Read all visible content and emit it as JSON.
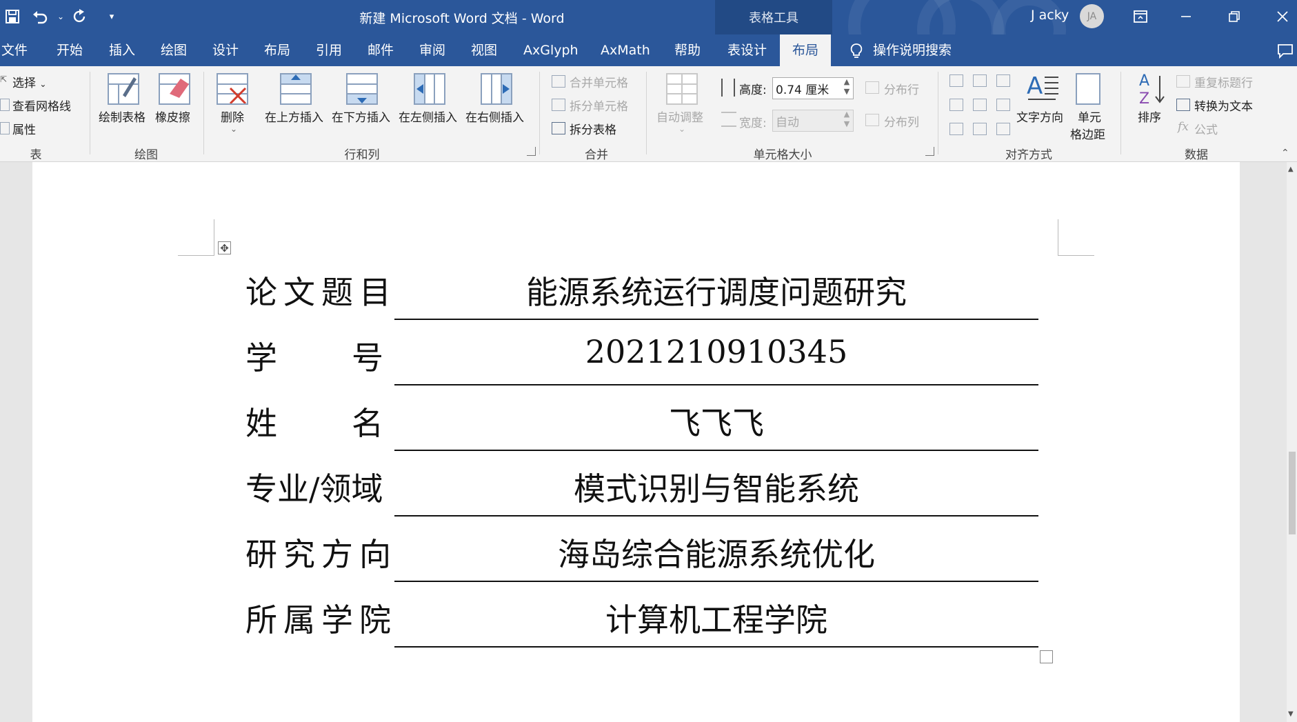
{
  "window": {
    "title": "新建 Microsoft Word 文档 - Word",
    "context_title": "表格工具",
    "user": "J acky",
    "avatar_initials": "JA",
    "accent": "#2b579a"
  },
  "qat": {
    "icons": [
      "save-icon",
      "undo-icon",
      "redo-icon",
      "customize-qat-icon"
    ]
  },
  "tabs": [
    "文件",
    "开始",
    "插入",
    "绘图",
    "设计",
    "布局",
    "引用",
    "邮件",
    "审阅",
    "视图",
    "AxGlyph",
    "AxMath",
    "帮助",
    "表设计",
    "布局"
  ],
  "active_tab_index": 14,
  "tell_me": "操作说明搜索",
  "ribbon": {
    "table": {
      "label": "表",
      "select": "选择",
      "gridlines": "查看网格线",
      "properties": "属性"
    },
    "draw": {
      "label": "绘图",
      "draw_table": "绘制表格",
      "eraser": "橡皮擦"
    },
    "rows_cols": {
      "label": "行和列",
      "delete": "删除",
      "insert_above": "在上方插入",
      "insert_below": "在下方插入",
      "insert_left": "在左侧插入",
      "insert_right": "在右侧插入"
    },
    "merge": {
      "label": "合并",
      "merge_cells": "合并单元格",
      "split_cells": "拆分单元格",
      "split_table": "拆分表格"
    },
    "cell_size": {
      "label": "单元格大小",
      "autofit": "自动调整",
      "height_label": "高度:",
      "height_value": "0.74 厘米",
      "width_label": "宽度:",
      "width_value": "自动",
      "distribute_rows": "分布行",
      "distribute_cols": "分布列"
    },
    "alignment": {
      "label": "对齐方式",
      "text_direction": "文字方向",
      "cell_margins_line1": "单元",
      "cell_margins_line2": "格边距"
    },
    "data": {
      "label": "数据",
      "sort": "排序",
      "repeat_header": "重复标题行",
      "convert_to_text": "转换为文本",
      "formula": "公式"
    }
  },
  "document": {
    "rows": [
      {
        "label": "论文题目",
        "value": "能源系统运行调度问题研究"
      },
      {
        "label": "学号",
        "value": "2021210910345"
      },
      {
        "label": "姓名",
        "value": "飞飞飞"
      },
      {
        "label": "专业/领域",
        "value": "模式识别与智能系统"
      },
      {
        "label": "研究方向",
        "value": "海岛综合能源系统优化"
      },
      {
        "label": "所属学院",
        "value": "计算机工程学院"
      }
    ],
    "label_chars": {
      "xue": "学",
      "hao": "号",
      "xing": "姓",
      "ming": "名"
    }
  }
}
